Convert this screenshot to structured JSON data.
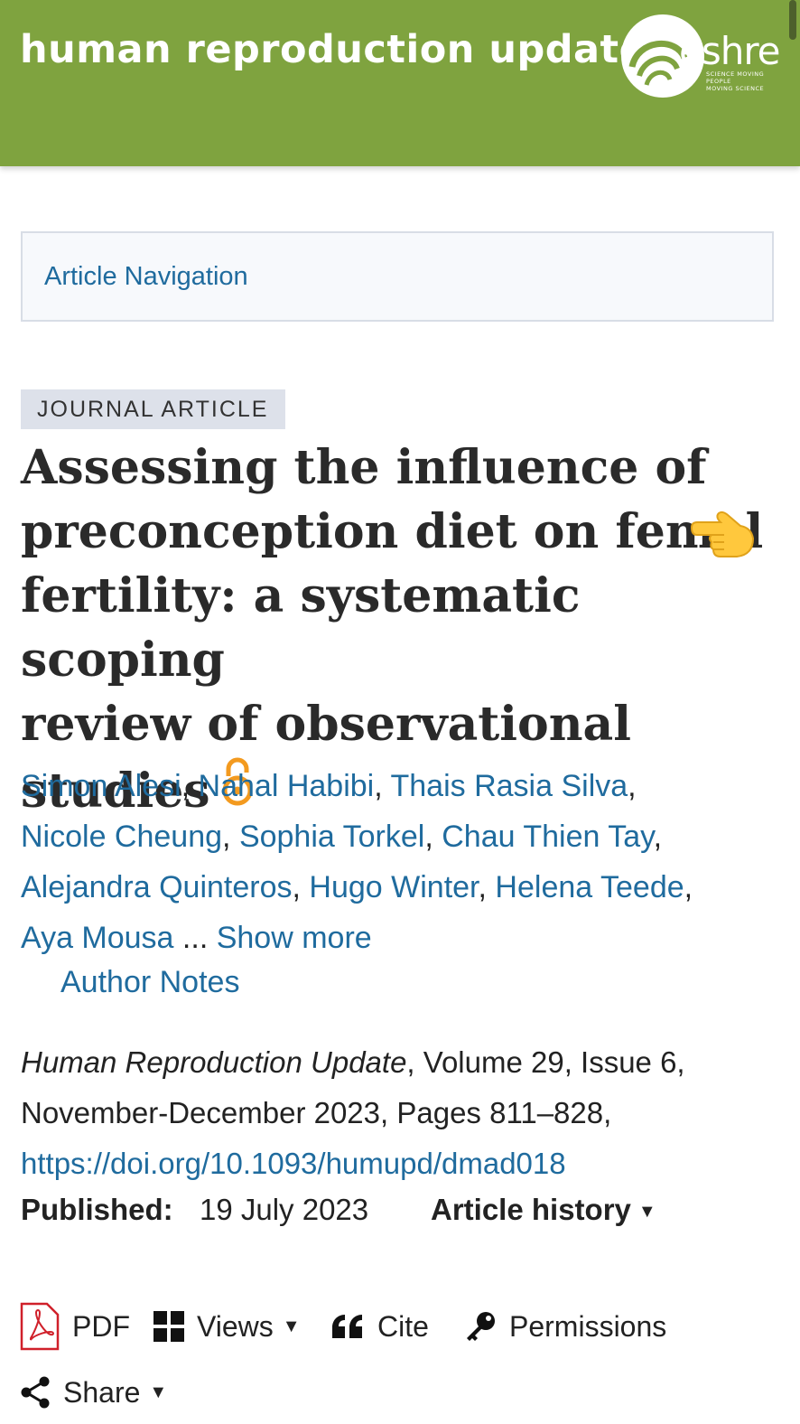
{
  "header": {
    "journal_title": "human reproduction update",
    "logo_text": "eshre",
    "logo_tagline_1": "SCIENCE MOVING",
    "logo_tagline_2": "PEOPLE",
    "logo_tagline_3": "MOVING SCIENCE",
    "color": "#7fa33f"
  },
  "nav": {
    "label": "Article Navigation"
  },
  "article": {
    "type": "JOURNAL ARTICLE",
    "title_line1": "Assessing the influence of",
    "title_line2": "preconception diet on femal",
    "title_line3": "fertility: a systematic scoping",
    "title_line4": "review of observational",
    "title_line5": "studies",
    "authors": [
      "Simon Alesi",
      "Nahal Habibi",
      "Thais Rasia Silva",
      "Nicole Cheung",
      "Sophia Torkel",
      "Chau Thien Tay",
      "Alejandra Quinteros",
      "Hugo Winter",
      "Helena Teede",
      "Aya Mousa"
    ],
    "ellipsis": "...",
    "show_more": "Show more",
    "author_notes": "Author Notes",
    "journal_name": "Human Reproduction Update",
    "volume_issue": ", Volume 29, Issue 6,",
    "date_pages": "November-December 2023, Pages 811–828,",
    "doi": "https://doi.org/10.1093/humupd/dmad018",
    "published_label": "Published:",
    "published_date": "19 July 2023",
    "history_label": "Article history"
  },
  "toolbar": {
    "pdf": "PDF",
    "views": "Views",
    "cite": "Cite",
    "permissions": "Permissions",
    "share": "Share"
  },
  "icons": {
    "pdf": "pdf-icon",
    "views": "grid-icon",
    "cite": "quote-icon",
    "permissions": "key-icon",
    "share": "share-icon",
    "open_access": "open-access-icon",
    "pointer": "pointing-hand-emoji"
  },
  "colors": {
    "link": "#1f6b9e",
    "open_access": "#f39a1f",
    "pdf_red": "#d0202a"
  }
}
